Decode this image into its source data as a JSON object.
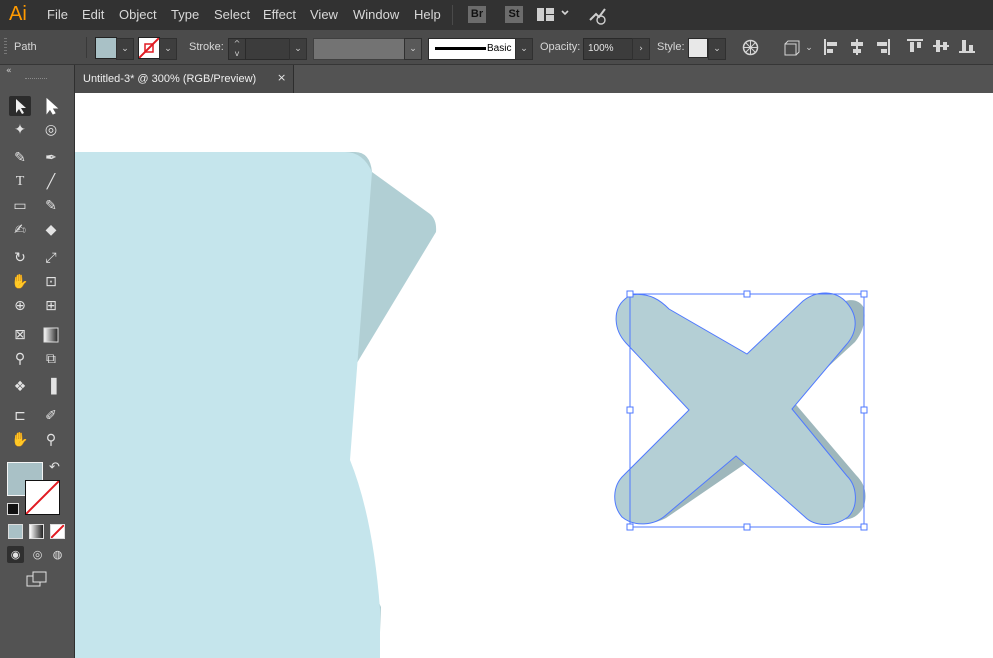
{
  "app": {
    "logo": "Ai",
    "menu": [
      "File",
      "Edit",
      "Object",
      "Type",
      "Select",
      "Effect",
      "View",
      "Window",
      "Help"
    ],
    "apps": [
      "Br",
      "St"
    ]
  },
  "control": {
    "selection_type": "Path",
    "stroke_label": "Stroke:",
    "brush_label": "Basic",
    "opacity_label": "Opacity:",
    "opacity_value": "100%",
    "style_label": "Style:"
  },
  "document": {
    "tab_title": "Untitled-3* @ 300% (RGB/Preview)",
    "close_icon": "×"
  },
  "colors": {
    "menubar": "#323232",
    "panel": "#535353",
    "control_bar": "#4b4b4b",
    "fill_swatch": "#a9c1c6",
    "selection": "#4f79ff",
    "shape_light": "#c5e5ec",
    "shape_shadow": "#b1cfd4",
    "x_shape": "#b4cfd5",
    "x_shadow": "#9eb7bc"
  },
  "icons": {
    "selection": "selection-tool-icon",
    "direct_selection": "direct-selection-tool-icon",
    "magic_wand": "magic-wand-tool-icon",
    "lasso": "lasso-tool-icon",
    "pen": "pen-tool-icon",
    "curvature": "curvature-tool-icon",
    "type": "type-tool-icon",
    "line": "line-segment-tool-icon",
    "rectangle": "rectangle-tool-icon",
    "paintbrush": "paintbrush-tool-icon",
    "shaper": "shaper-tool-icon",
    "eraser": "eraser-tool-icon",
    "rotate": "rotate-tool-icon",
    "scale": "scale-tool-icon",
    "warp": "warp-tool-icon",
    "free_transform": "free-transform-tool-icon",
    "shape_builder": "shape-builder-tool-icon",
    "perspective": "perspective-grid-tool-icon",
    "mesh": "mesh-tool-icon",
    "gradient": "gradient-tool-icon",
    "eyedropper": "eyedropper-tool-icon",
    "blend": "blend-tool-icon",
    "symbol_sprayer": "symbol-sprayer-tool-icon",
    "graph": "column-graph-tool-icon",
    "artboard": "artboard-tool-icon",
    "slice": "slice-tool-icon",
    "hand": "hand-tool-icon",
    "zoom": "zoom-tool-icon"
  }
}
